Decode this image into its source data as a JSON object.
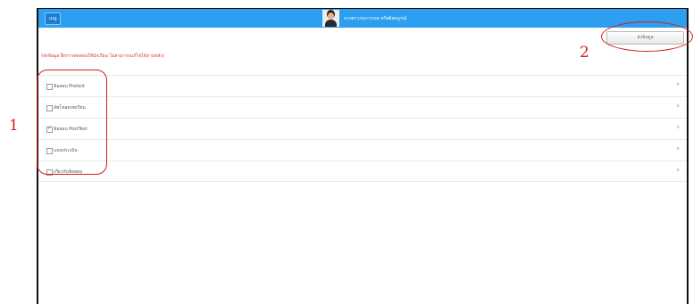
{
  "header": {
    "menu_button": "เมนู",
    "user_name": "นางสาวกนกวรรณ ทรัพย์สมบูรณ์"
  },
  "toolbar": {
    "submit_label": "ส่งข้อมูล"
  },
  "notice": "(ส่งข้อมูล ฝึกการทดสอบให้นักเรียน ไม่สามารถแก้ไขได้ภายหลัง)",
  "menu_items": [
    {
      "label": "ข้อสอบ Pretest",
      "checked": false
    },
    {
      "label": "อัพโหลดบทเรียน",
      "checked": false
    },
    {
      "label": "ข้อสอบ PostTest",
      "checked": true
    },
    {
      "label": "แบบประเมิน",
      "checked": false
    },
    {
      "label": "เกี่ยวกับข้อสอบ",
      "checked": false
    }
  ],
  "annotations": {
    "label_1": "1",
    "label_2": "2"
  },
  "colors": {
    "header_bg": "#2d9ff0",
    "notice_text": "#e0303a",
    "annotation": "#d31d1d"
  }
}
